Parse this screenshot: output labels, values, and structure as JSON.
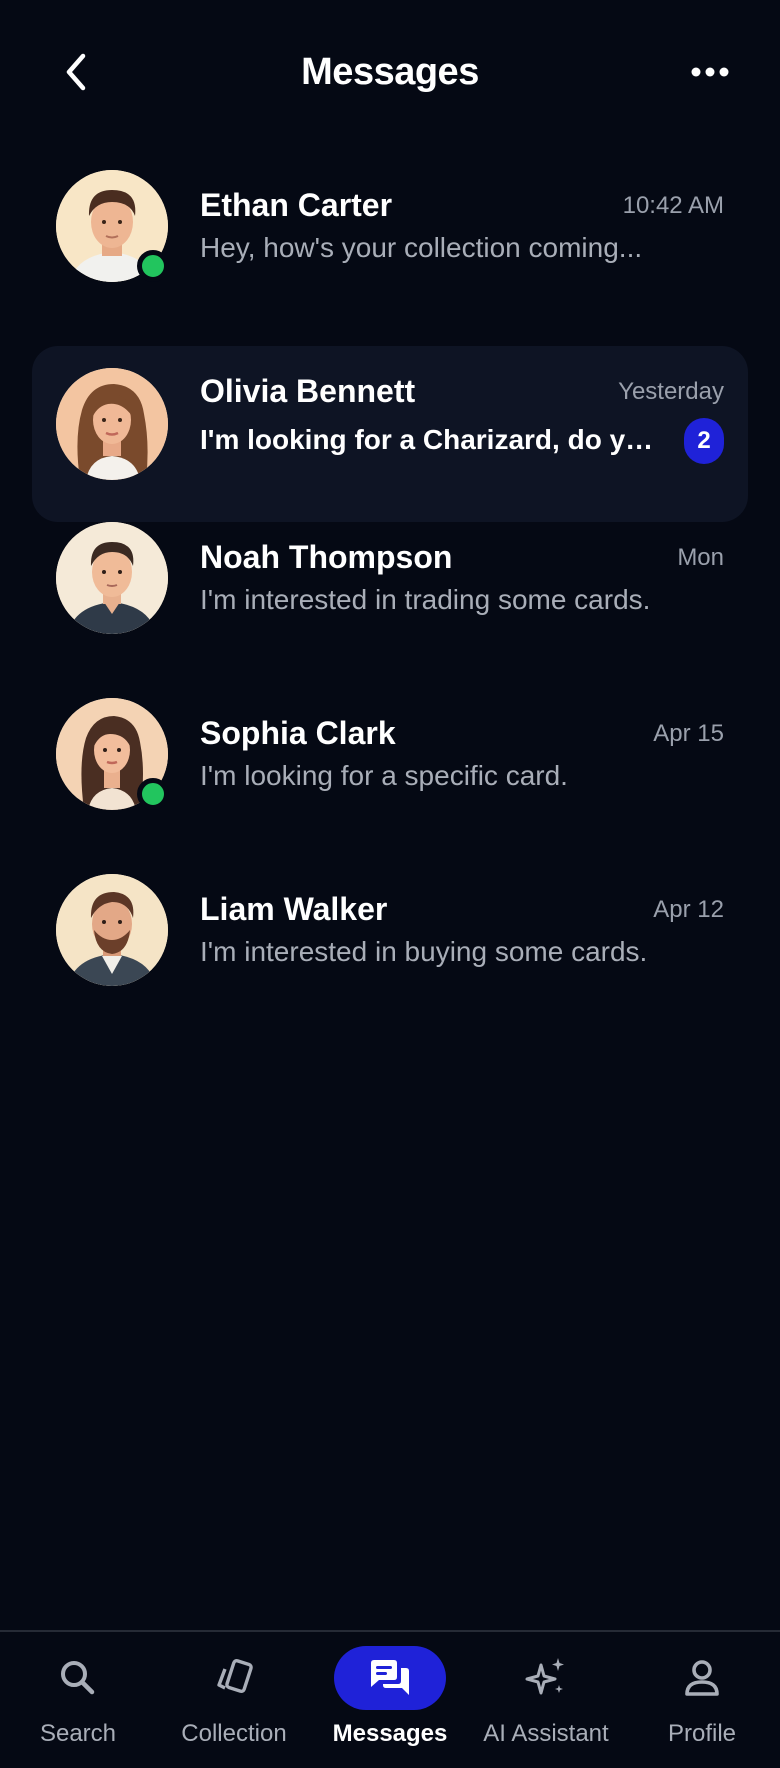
{
  "header": {
    "title": "Messages",
    "back_icon": "chevron-left-icon",
    "more_icon": "more-horizontal-icon"
  },
  "conversations": [
    {
      "name": "Ethan Carter",
      "time": "10:42 AM",
      "preview": "Hey, how's your collection coming...",
      "online": true,
      "unread": "",
      "highlighted": false
    },
    {
      "name": "Olivia Bennett",
      "time": "Yesterday",
      "preview": "I'm looking for a Charizard, do you...",
      "online": false,
      "unread": "2",
      "highlighted": true
    },
    {
      "name": "Noah Thompson",
      "time": "Mon",
      "preview": "I'm interested in trading some cards.",
      "online": false,
      "unread": "",
      "highlighted": false
    },
    {
      "name": "Sophia Clark",
      "time": "Apr 15",
      "preview": "I'm looking for a specific card.",
      "online": true,
      "unread": "",
      "highlighted": false
    },
    {
      "name": "Liam Walker",
      "time": "Apr 12",
      "preview": "I'm interested in buying some cards.",
      "online": false,
      "unread": "",
      "highlighted": false
    }
  ],
  "nav": {
    "items": [
      {
        "label": "Search",
        "icon": "search-icon"
      },
      {
        "label": "Collection",
        "icon": "cards-icon"
      },
      {
        "label": "Messages",
        "icon": "messages-icon",
        "active": true
      },
      {
        "label": "AI Assistant",
        "icon": "sparkles-icon"
      },
      {
        "label": "Profile",
        "icon": "user-icon"
      }
    ]
  },
  "colors": {
    "background": "#050914",
    "accent": "#1f22d8",
    "online": "#22c55e",
    "highlight_row": "#0e1424"
  }
}
